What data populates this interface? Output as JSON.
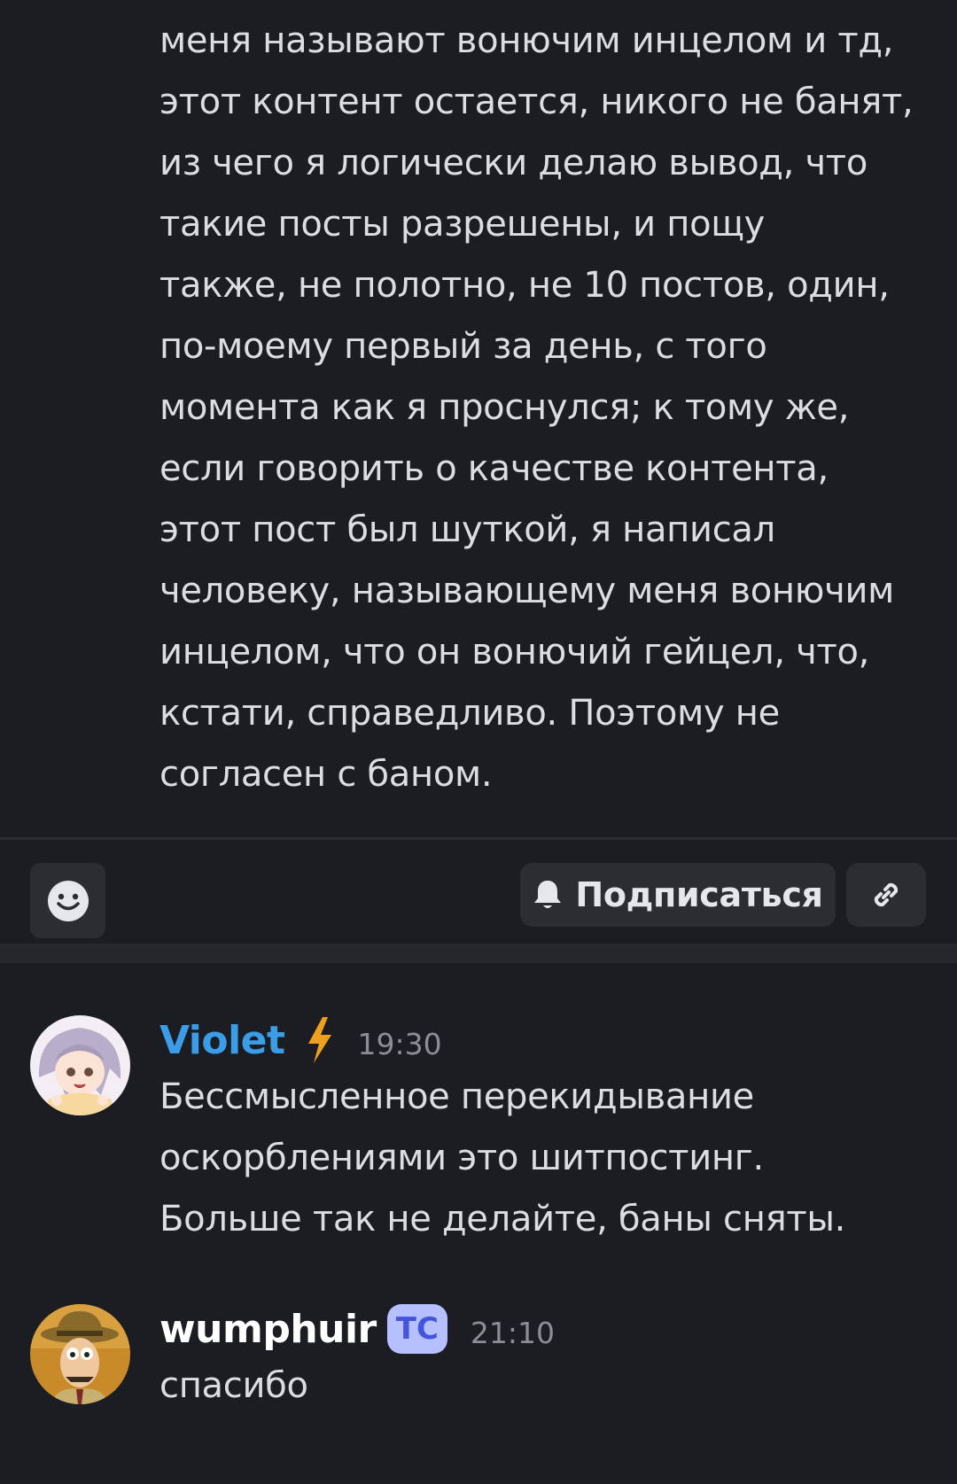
{
  "post": {
    "lines": [
      "меня называют вонючим инцелом и тд,",
      "этот контент остается, никого не банят,",
      "из чего я логически делаю вывод, что",
      "такие посты разрешены, и пощу",
      "также, не полотно, не 10 постов, один,",
      "по-моему первый за день, с того",
      "момента как я проснулся; к тому же,",
      "если говорить о качестве контента,",
      "этот пост был шуткой, я написал",
      "человеку, называющему меня вонючим",
      "инцелом, что он вонючий гейцел, что,",
      "кстати, справедливо. Поэтому не",
      "согласен с баном."
    ]
  },
  "actions": {
    "react_icon": "smiley-icon",
    "subscribe_icon": "bell-icon",
    "subscribe_label": "Подписаться",
    "link_icon": "link-icon"
  },
  "messages": [
    {
      "username": "Violet",
      "username_color": "#3b9ce8",
      "badge_icon": "lightning-icon",
      "badge_color": "#f0a020",
      "time": "19:30",
      "lines": [
        "Бессмысленное перекидывание",
        "оскорблениями это шитпостинг.",
        "Больше так не делайте, баны сняты."
      ]
    },
    {
      "username": "wumphuir",
      "username_color": "#ffffff",
      "badge_text": "ТС",
      "time": "21:10",
      "lines": [
        "спасибо"
      ]
    }
  ],
  "colors": {
    "background": "#1c1d22",
    "button_bg": "#2b2d33",
    "text": "#dbdee1",
    "muted": "#8b8e96"
  }
}
